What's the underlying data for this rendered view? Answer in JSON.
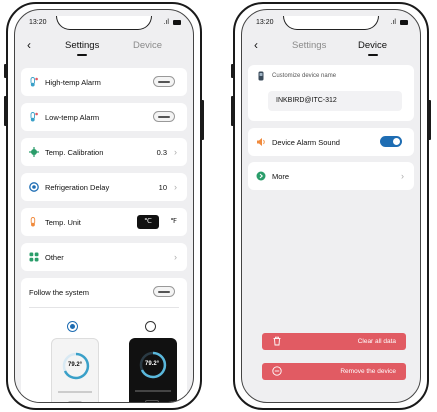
{
  "left": {
    "time": "13:20",
    "tabs": {
      "settings": "Settings",
      "device": "Device"
    },
    "rows": {
      "high_alarm": "High-temp Alarm",
      "low_alarm": "Low-temp Alarm",
      "calibration": "Temp. Calibration",
      "calibration_value": "0.3",
      "refrigeration": "Refrigeration Delay",
      "refrigeration_value": "10",
      "unit": "Temp. Unit",
      "unit_c": "℃",
      "unit_f": "℉",
      "other": "Other",
      "follow": "Follow the system"
    },
    "themes": {
      "light_value": "79.2",
      "light_unit": "°",
      "dark_value": "79.2",
      "dark_unit": "°"
    }
  },
  "right": {
    "time": "13:20",
    "tabs": {
      "settings": "Settings",
      "device": "Device"
    },
    "name_label": "Customize device name",
    "device_name": "INKBIRD@ITC-312",
    "alarm_sound": "Device Alarm Sound",
    "more": "More",
    "clear": "Clear all data",
    "remove": "Remove the device"
  },
  "colors": {
    "accent": "#1e6db3",
    "danger": "#e15b63",
    "green": "#2a9d6a",
    "orange": "#f08a3c"
  }
}
